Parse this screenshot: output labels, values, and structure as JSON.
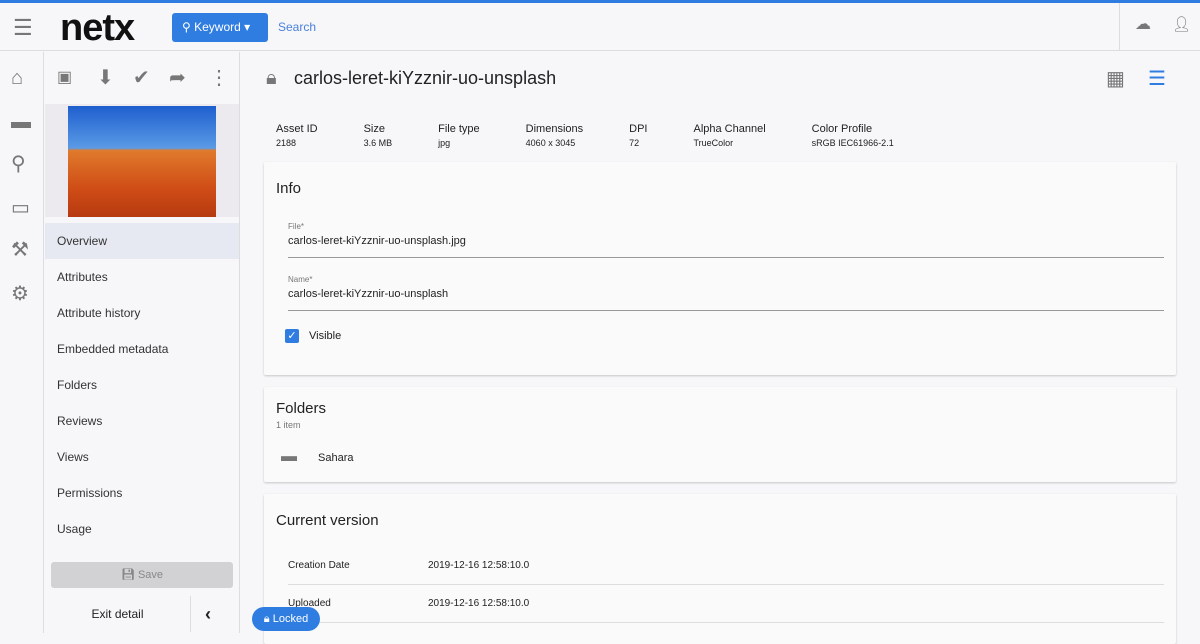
{
  "header": {
    "logo": "netx",
    "keyword_label": "Keyword",
    "search_placeholder": "Search"
  },
  "sidebar": {
    "nav": [
      "Overview",
      "Attributes",
      "Attribute history",
      "Embedded metadata",
      "Folders",
      "Reviews",
      "Views",
      "Permissions",
      "Usage"
    ],
    "save_label": "Save",
    "exit_label": "Exit detail"
  },
  "asset": {
    "title": "carlos-leret-kiYzznir-uo-unsplash",
    "meta": [
      {
        "label": "Asset ID",
        "value": "2188"
      },
      {
        "label": "Size",
        "value": "3.6 MB"
      },
      {
        "label": "File type",
        "value": "jpg"
      },
      {
        "label": "Dimensions",
        "value": "4060 x 3045"
      },
      {
        "label": "DPI",
        "value": "72"
      },
      {
        "label": "Alpha Channel",
        "value": "TrueColor"
      },
      {
        "label": "Color Profile",
        "value": "sRGB IEC61966-2.1"
      }
    ]
  },
  "info": {
    "heading": "Info",
    "file_label": "File*",
    "file_value": "carlos-leret-kiYzznir-uo-unsplash.jpg",
    "name_label": "Name*",
    "name_value": "carlos-leret-kiYzznir-uo-unsplash",
    "visible_label": "Visible"
  },
  "folders": {
    "heading": "Folders",
    "count": "1 item",
    "items": [
      "Sahara"
    ]
  },
  "version": {
    "heading": "Current version",
    "rows": [
      {
        "label": "Creation Date",
        "value": "2019-12-16 12:58:10.0"
      },
      {
        "label": "Uploaded",
        "value": "2019-12-16 12:58:10.0"
      }
    ]
  },
  "locked_label": "Locked"
}
